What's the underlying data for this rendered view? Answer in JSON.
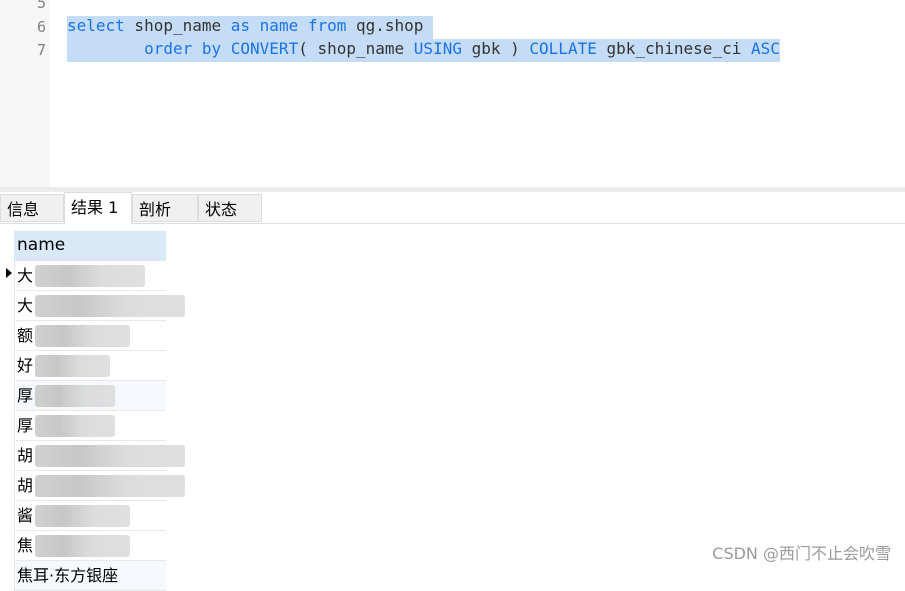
{
  "editor": {
    "line_numbers": [
      "5",
      "6",
      "7"
    ],
    "line6": {
      "t1": "select",
      "t2": " shop_name ",
      "t3": "as",
      "t4": " ",
      "t5": "name",
      "t6": " ",
      "t7": "from",
      "t8": " qg.shop "
    },
    "line7": {
      "indent": "        ",
      "t1": "order by",
      "t2": " ",
      "t3": "CONVERT",
      "t4": "( shop_name ",
      "t5": "USING",
      "t6": " gbk ) ",
      "t7": "COLLATE",
      "t8": " gbk_chinese_ci ",
      "t9": "ASC"
    }
  },
  "tabs": [
    {
      "label": "信息"
    },
    {
      "label": "结果 1",
      "active": true
    },
    {
      "label": "剖析"
    },
    {
      "label": "状态"
    }
  ],
  "results": {
    "column": "name",
    "rows": [
      "大",
      "大",
      "额",
      "好",
      "厚",
      "厚",
      "胡",
      "胡",
      "酱",
      "焦",
      "焦耳·东方银座"
    ]
  },
  "watermark": "CSDN @西门不止会吹雪"
}
